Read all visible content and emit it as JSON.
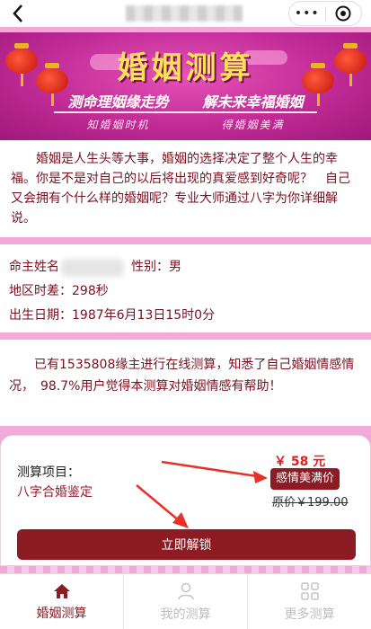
{
  "nav": {
    "back_icon": "chevron-left-icon",
    "more_icon": "more-dots-icon",
    "close_icon": "target-ring-icon"
  },
  "banner": {
    "title": "婚姻测算",
    "slogan_left": "测命理姻缘走势",
    "slogan_right": "解未来幸福婚姻",
    "sub_left": "知婚姻时机",
    "sub_right": "得婚姻美满"
  },
  "intro": {
    "text": "婚姻是人生头等大事，婚姻的选择决定了整个人生的幸福。你是不是对自己的以后将出现的真爱感到好奇呢？　自己又会拥有个什么样的婚姻呢？专业大师通过八字为你详细解说。"
  },
  "info": {
    "name_label": "命主姓名",
    "gender_label": "性别：",
    "gender_value": "男",
    "region_label": "地区时差：",
    "region_value": "298秒",
    "birth_label": "出生日期：",
    "birth_value": "1987年6月13日15时0分"
  },
  "stats": {
    "text": "已有1535808缘主进行在线测算，知悉了自己婚姻情感情况，　98.7%用户觉得本测算对婚姻情感有帮助！"
  },
  "purchase": {
    "item_label": "测算项目：",
    "item_value": "八字合婚鉴定",
    "price": "￥ 58 元",
    "badge": "感情美满价",
    "original_price": "原价￥199.00",
    "unlock_label": "立即解锁"
  },
  "tabs": [
    {
      "label": "婚姻测算",
      "icon": "home-icon",
      "active": true
    },
    {
      "label": "我的测算",
      "icon": "user-icon",
      "active": false
    },
    {
      "label": "更多测算",
      "icon": "grid-icon",
      "active": false
    }
  ],
  "colors": {
    "accent": "#8c1b24",
    "banner": "#c12b96",
    "price": "#e02020",
    "page_bg": "#f0a8d8"
  }
}
